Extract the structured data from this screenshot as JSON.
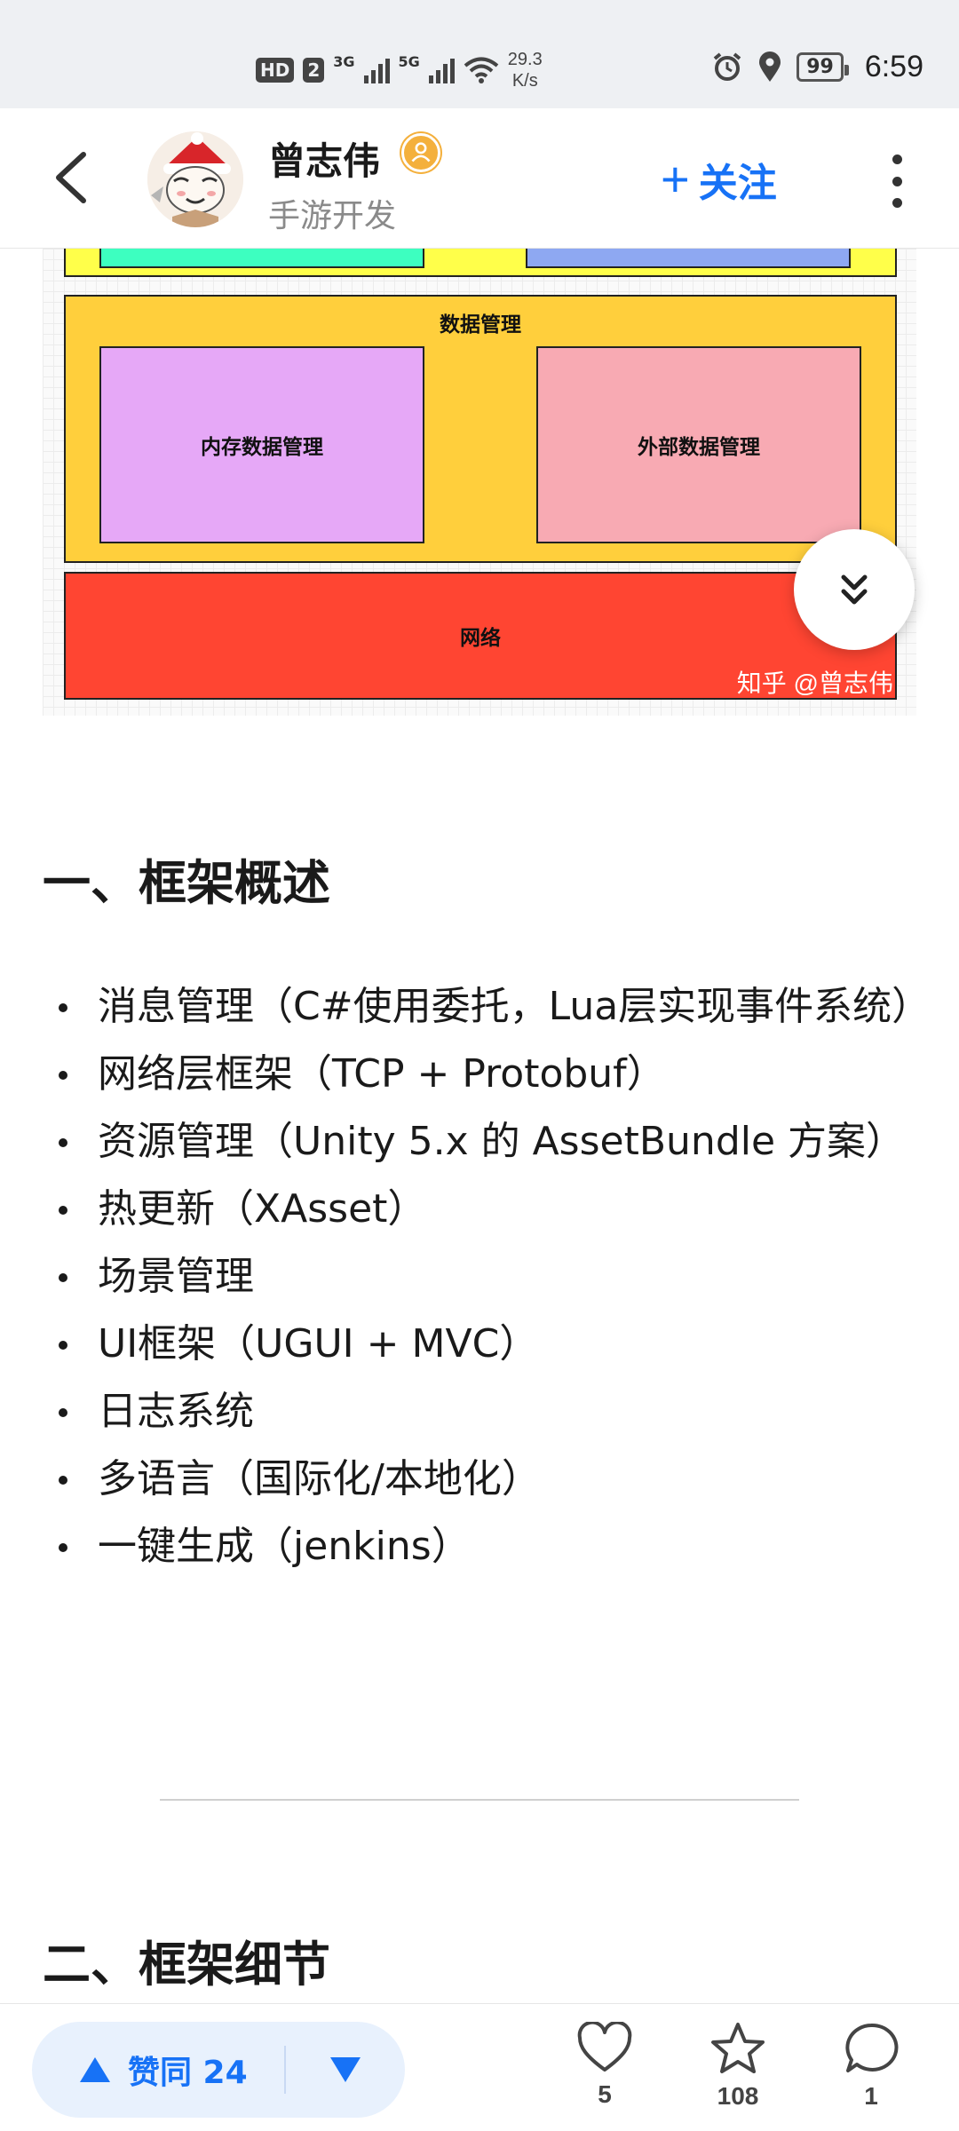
{
  "status_bar": {
    "hd": "HD",
    "sim": "2",
    "net1": "3G",
    "net2": "5G",
    "speed_value": "29.3",
    "speed_unit": "K/s",
    "battery": "99",
    "time": "6:59"
  },
  "header": {
    "author_name": "曾志伟",
    "author_subtitle": "手游开发",
    "follow_label": "关注"
  },
  "diagram": {
    "data_management": "数据管理",
    "memory_data": "内存数据管理",
    "external_data": "外部数据管理",
    "network": "网络",
    "watermark": "知乎 @曾志伟",
    "colors": {
      "top_bar": "#ffff4a",
      "green": "#3dffc0",
      "blue": "#8ea8f2",
      "data_management": "#ffcf3c",
      "memory": "#e6a8f7",
      "external": "#f8aab3",
      "network": "#ff4532"
    }
  },
  "article": {
    "section1_title": "一、框架概述",
    "items": [
      "消息管理（C#使用委托，Lua层实现事件系统）",
      "网络层框架（TCP + Protobuf）",
      "资源管理（Unity 5.x 的 AssetBundle 方案）",
      "热更新（XAsset）",
      "场景管理",
      "UI框架（UGUI + MVC）",
      "日志系统",
      "多语言（国际化/本地化）",
      "一键生成（jenkins）"
    ],
    "section2_title": "二、框架细节"
  },
  "bottom_bar": {
    "upvote_label": "赞同 24",
    "like_count": "5",
    "favorite_count": "108",
    "comment_count": "1"
  },
  "accent_color": "#1772f6"
}
